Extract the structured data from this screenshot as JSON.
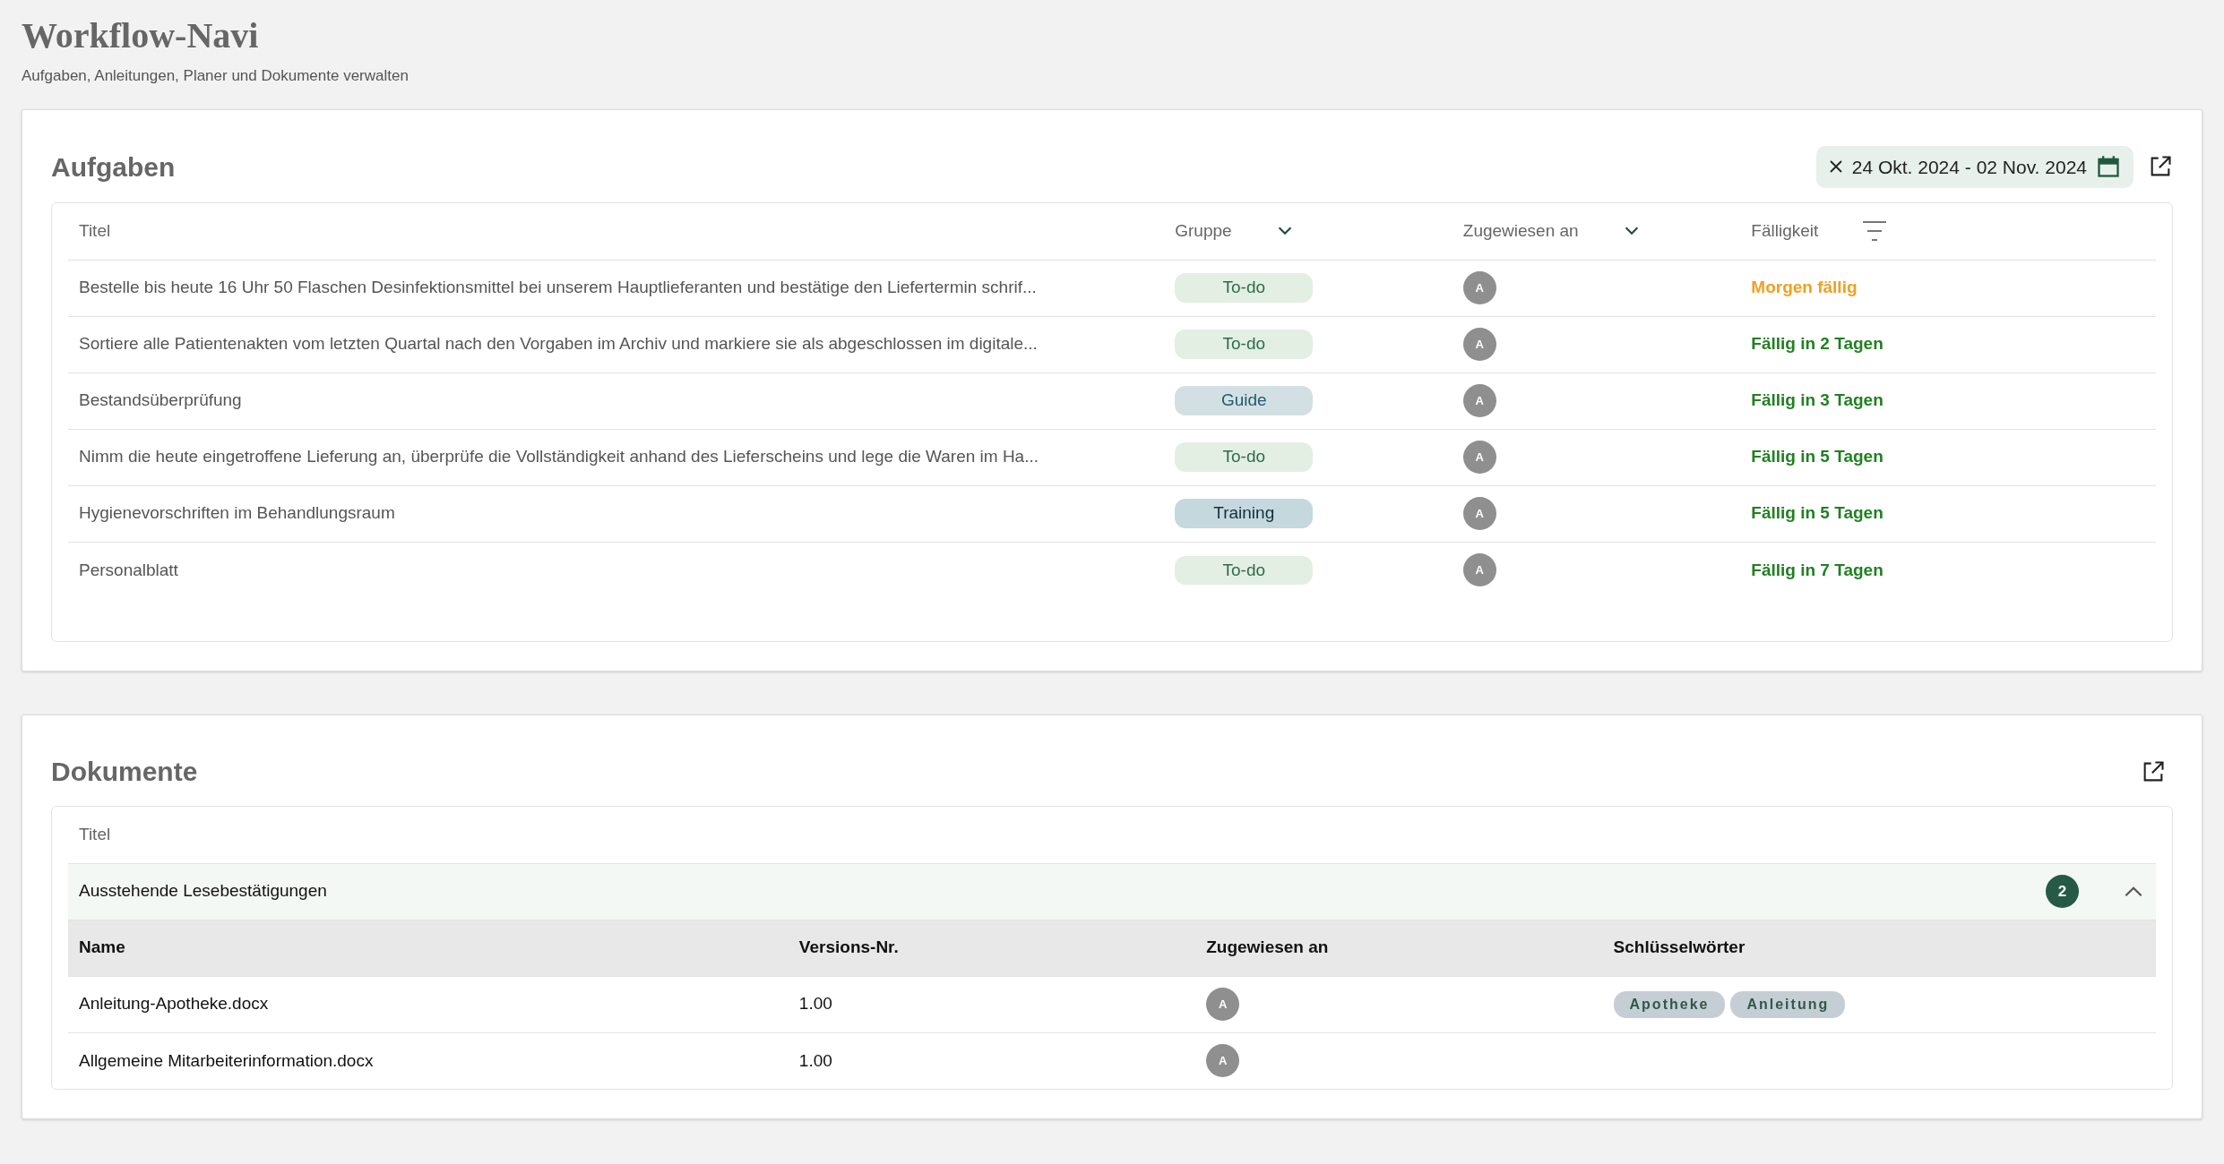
{
  "header": {
    "title": "Workflow-Navi",
    "subtitle": "Aufgaben, Anleitungen, Planer und Dokumente verwalten"
  },
  "tasks": {
    "title": "Aufgaben",
    "date_filter": "24 Okt. 2024 - 02 Nov. 2024",
    "columns": [
      {
        "label": "Titel",
        "kind": "plain"
      },
      {
        "label": "Gruppe",
        "kind": "dropdown"
      },
      {
        "label": "Zugewiesen an",
        "kind": "dropdown"
      },
      {
        "label": "Fälligkeit",
        "kind": "filter"
      }
    ],
    "rows": [
      {
        "title": "Bestelle bis heute 16 Uhr 50 Flaschen Desinfektionsmittel bei unserem Hauptlieferanten und bestätige den Liefertermin schrif...",
        "group": {
          "label": "To-do",
          "kind": "todo"
        },
        "assignee": "A",
        "due": {
          "text": "Morgen fällig",
          "kind": "soon"
        }
      },
      {
        "title": "Sortiere alle Patientenakten vom letzten Quartal nach den Vorgaben im Archiv und markiere sie als abgeschlossen im digitale...",
        "group": {
          "label": "To-do",
          "kind": "todo"
        },
        "assignee": "A",
        "due": {
          "text": "Fällig in 2 Tagen",
          "kind": "ok"
        }
      },
      {
        "title": "Bestandsüberprüfung",
        "group": {
          "label": "Guide",
          "kind": "guide"
        },
        "assignee": "A",
        "due": {
          "text": "Fällig in 3 Tagen",
          "kind": "ok"
        }
      },
      {
        "title": "Nimm die heute eingetroffene Lieferung an, überprüfe die Vollständigkeit anhand des Lieferscheins und lege die Waren im Ha...",
        "group": {
          "label": "To-do",
          "kind": "todo"
        },
        "assignee": "A",
        "due": {
          "text": "Fällig in 5 Tagen",
          "kind": "ok"
        }
      },
      {
        "title": "Hygienevorschriften im Behandlungsraum",
        "group": {
          "label": "Training",
          "kind": "training"
        },
        "assignee": "A",
        "due": {
          "text": "Fällig in 5 Tagen",
          "kind": "ok"
        }
      },
      {
        "title": "Personalblatt",
        "group": {
          "label": "To-do",
          "kind": "todo"
        },
        "assignee": "A",
        "due": {
          "text": "Fällig in 7 Tagen",
          "kind": "ok"
        }
      }
    ]
  },
  "documents": {
    "title": "Dokumente",
    "column": "Titel",
    "group": {
      "label": "Ausstehende Lesebestätigungen",
      "count": "2",
      "expanded": true,
      "columns": [
        "Name",
        "Versions-Nr.",
        "Zugewiesen an",
        "Schlüsselwörter"
      ],
      "rows": [
        {
          "name": "Anleitung-Apotheke.docx",
          "version": "1.00",
          "assignee": "A",
          "keywords": [
            "Apotheke",
            "Anleitung"
          ]
        },
        {
          "name": "Allgemeine Mitarbeiterinformation.docx",
          "version": "1.00",
          "assignee": "A",
          "keywords": []
        }
      ]
    }
  }
}
